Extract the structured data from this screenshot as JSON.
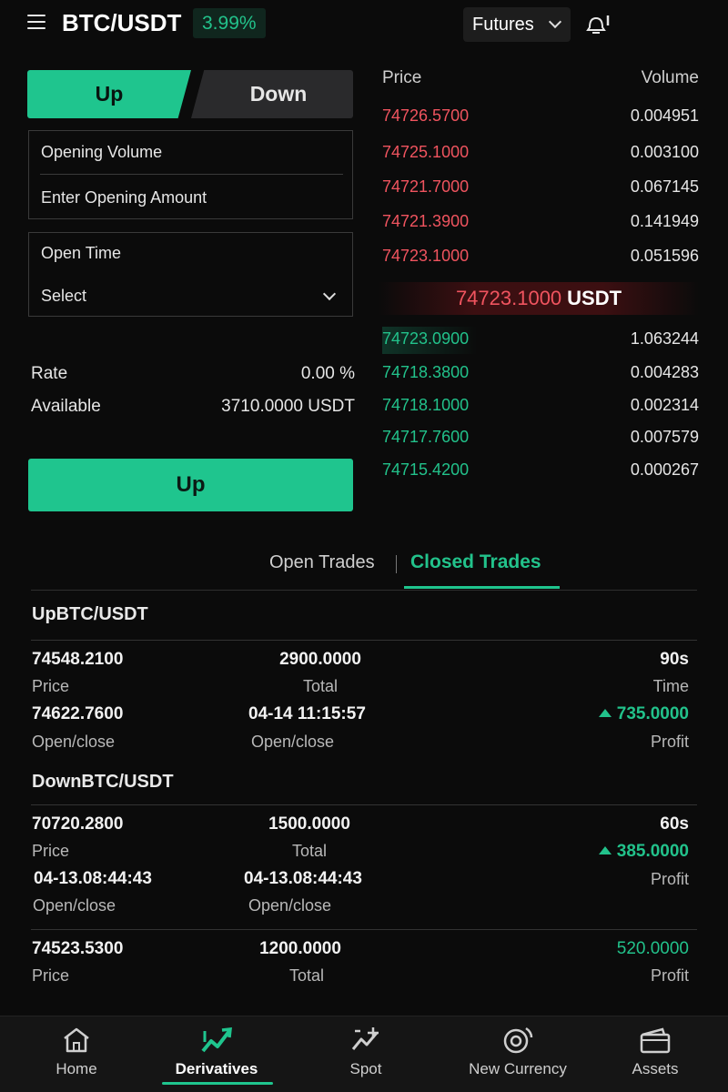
{
  "header": {
    "pair": "BTC/USDT",
    "change": "3.99%",
    "futures_label": "Futures"
  },
  "order_form": {
    "up_tab": "Up",
    "down_tab": "Down",
    "opening_volume_label": "Opening Volume",
    "opening_amount_placeholder": "Enter Opening Amount",
    "open_time_label": "Open Time",
    "open_time_value": "Select",
    "rate_label": "Rate",
    "rate_value": "0.00 %",
    "available_label": "Available",
    "available_value": "3710.0000 USDT",
    "submit_label": "Up"
  },
  "order_book": {
    "price_header": "Price",
    "volume_header": "Volume",
    "asks": [
      {
        "price": "74726.5700",
        "volume": "0.004951"
      },
      {
        "price": "74725.1000",
        "volume": "0.003100"
      },
      {
        "price": "74721.7000",
        "volume": "0.067145"
      },
      {
        "price": "74721.3900",
        "volume": "0.141949"
      },
      {
        "price": "74723.1000",
        "volume": "0.051596"
      }
    ],
    "mid_price": "74723.1000",
    "mid_unit": "USDT",
    "bids": [
      {
        "price": "74723.0900",
        "volume": "1.063244"
      },
      {
        "price": "74718.3800",
        "volume": "0.004283"
      },
      {
        "price": "74718.1000",
        "volume": "0.002314"
      },
      {
        "price": "74717.7600",
        "volume": "0.007579"
      },
      {
        "price": "74715.4200",
        "volume": "0.000267"
      }
    ]
  },
  "trades_tabs": {
    "open": "Open Trades",
    "closed": "Closed Trades",
    "active": "closed"
  },
  "closed_trades": [
    {
      "title": "UpBTC/USDT",
      "price": "74548.2100",
      "price_label": "Price",
      "total": "2900.0000",
      "total_label": "Total",
      "time": "90s",
      "time_label": "Time",
      "open_price": "74622.7600",
      "open_price_label": "Open/close",
      "open_time": "04-14 11:15:57",
      "open_time_label": "Open/close",
      "profit": "735.0000",
      "profit_label": "Profit"
    },
    {
      "title": "DownBTC/USDT",
      "price": "70720.2800",
      "price_label": "Price",
      "total": "1500.0000",
      "total_label": "Total",
      "time": "60s",
      "profit": "385.0000",
      "profit_label": "Profit",
      "open_price": "04-13.08:44:43",
      "open_price_label": "Open/close",
      "open_time": "04-13.08:44:43",
      "open_time_label": "Open/close"
    },
    {
      "price": "74523.5300",
      "price_label": "Price",
      "total": "1200.0000",
      "total_label": "Total",
      "profit": "520.0000",
      "profit_label": "Profit"
    }
  ],
  "bottom_nav": [
    {
      "label": "Home",
      "icon": "home-icon"
    },
    {
      "label": "Derivatives",
      "icon": "derivatives-icon",
      "active": true
    },
    {
      "label": "Spot",
      "icon": "spot-icon"
    },
    {
      "label": "New Currency",
      "icon": "new-currency-icon"
    },
    {
      "label": "Assets",
      "icon": "wallet-icon"
    }
  ],
  "colors": {
    "accent_green": "#1fc58e",
    "ask_red": "#f0545f",
    "background": "#0b0b0b"
  }
}
